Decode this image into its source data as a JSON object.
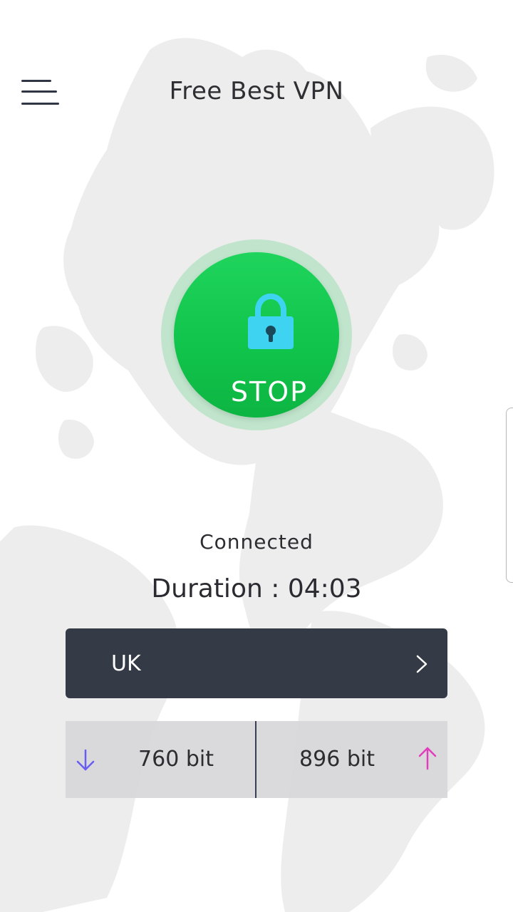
{
  "header": {
    "title": "Free Best VPN"
  },
  "connection": {
    "button_label": "STOP",
    "status": "Connected",
    "duration_label": "Duration :",
    "duration_value": "04:03"
  },
  "server": {
    "selected": "UK"
  },
  "traffic": {
    "download": "760 bit",
    "upload": "896 bit"
  },
  "colors": {
    "accent_green": "#10c34a",
    "panel_dark": "#343a46",
    "lock_blue": "#3fd3f2",
    "download_arrow": "#6a5df2",
    "upload_arrow": "#e23dbd"
  },
  "icons": {
    "menu": "hamburger-menu-icon",
    "lock": "lock-icon",
    "chevron": "chevron-right-icon",
    "download": "arrow-down-icon",
    "upload": "arrow-up-icon"
  }
}
